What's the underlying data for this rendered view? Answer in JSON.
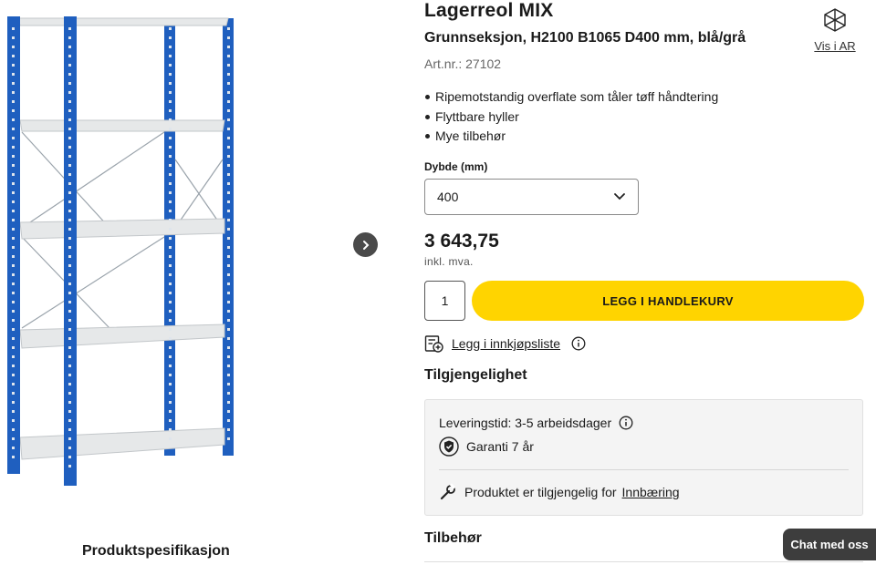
{
  "product": {
    "title": "Lagerreol MIX",
    "subtitle": "Grunnseksjon, H2100 B1065 D400 mm, blå/grå",
    "art_nr": "Art.nr.: 27102",
    "ar_label": "Vis i AR",
    "features": [
      "Ripemotstandig overflate som tåler tøff håndtering",
      "Flyttbare hyller",
      "Mye tilbehør"
    ]
  },
  "depth": {
    "label": "Dybde (mm)",
    "selected": "400"
  },
  "price": {
    "value": "3 643,75",
    "vat_note": "inkl. mva."
  },
  "purchase": {
    "quantity": "1",
    "add_to_cart_label": "LEGG I HANDLEKURV",
    "shopping_list_label": "Legg i innkjøpsliste"
  },
  "availability": {
    "title": "Tilgjengelighet",
    "delivery": "Leveringstid: 3-5 arbeidsdager",
    "warranty": "Garanti 7 år",
    "carry_in_prefix": "Produktet er tilgjengelig for",
    "carry_in_link": "Innbæring"
  },
  "accessories_title": "Tilbehør",
  "spec_tab": "Produktspesifikasjon",
  "chat_label": "Chat med oss",
  "colors": {
    "accent_yellow": "#ffd400",
    "upright_blue": "#1f5fbf",
    "shelf_grey": "#e6e8e9"
  }
}
